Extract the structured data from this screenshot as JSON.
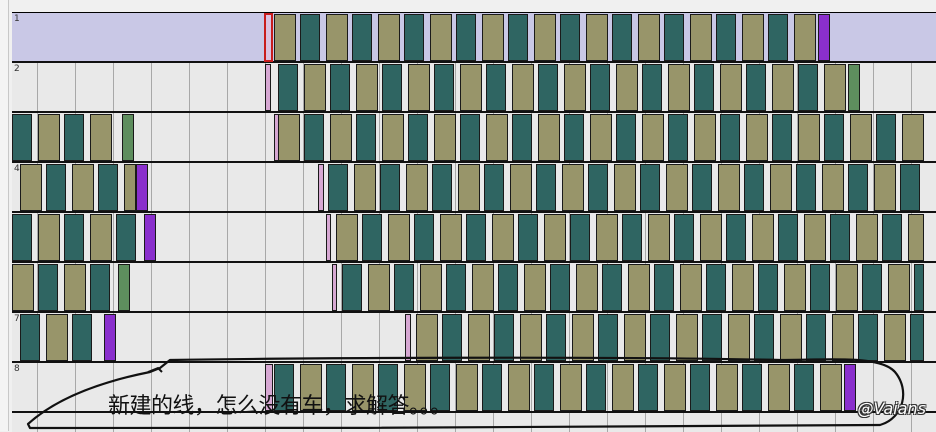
{
  "tracks": [
    {
      "label": "1",
      "selected": true
    },
    {
      "label": "2",
      "selected": false
    },
    {
      "label": "",
      "selected": false
    },
    {
      "label": "4",
      "selected": false
    },
    {
      "label": "",
      "selected": false
    },
    {
      "label": "",
      "selected": false
    },
    {
      "label": "7",
      "selected": false
    },
    {
      "label": "8",
      "selected": false
    }
  ],
  "annotation": {
    "text": "新建的线，怎么没有车，求解答。。。"
  },
  "watermark": {
    "text": "@Vaians"
  },
  "colors": {
    "selected_track_bg": "#c9c8e6",
    "track_bg": "#e9e9e9",
    "block_teal": "#2f6562",
    "block_olive": "#98956a",
    "block_purple": "#8a2fcc",
    "block_green": "#5e8e5e",
    "block_pink": "#d7a8d3",
    "marker_red": "#c81c1c",
    "gridline": "#a8a8a8"
  }
}
